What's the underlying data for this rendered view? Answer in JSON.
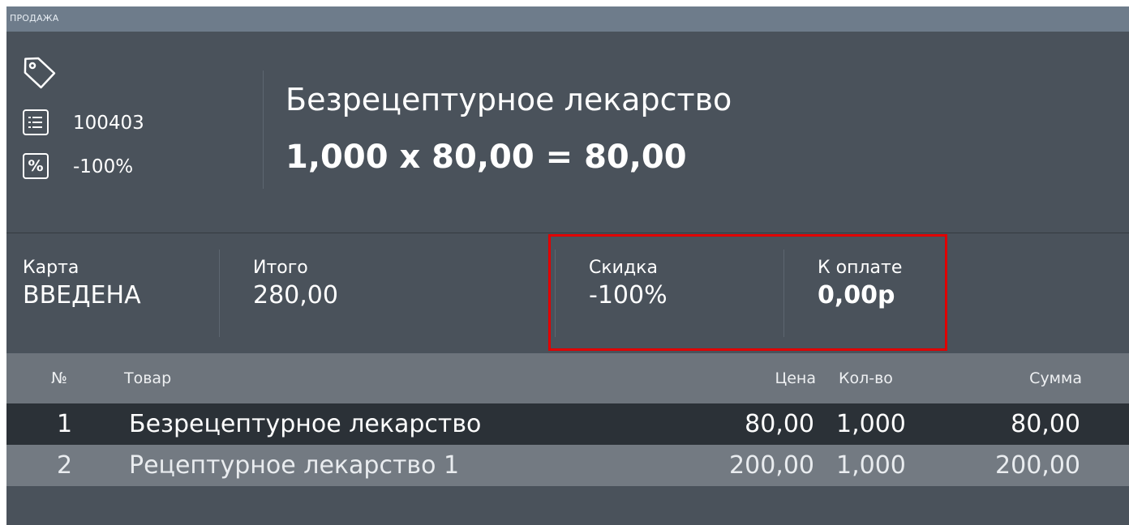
{
  "window": {
    "title": "ПРОДАЖА"
  },
  "product": {
    "code": "100403",
    "discount": "-100%",
    "name": "Безрецептурное лекарство",
    "calculation": "1,000 x 80,00 = 80,00"
  },
  "totals": {
    "card_label": "Карта",
    "card_value": "ВВЕДЕНА",
    "total_label": "Итого",
    "total_value": "280,00",
    "discount_label": "Скидка",
    "discount_value": "-100%",
    "pay_label": "К оплате",
    "pay_value": "0,00р"
  },
  "table": {
    "headers": {
      "num": "№",
      "item": "Товар",
      "price": "Цена",
      "qty": "Кол-во",
      "sum": "Сумма"
    },
    "rows": [
      {
        "num": "1",
        "item": "Безрецептурное лекарство",
        "price": "80,00",
        "qty": "1,000",
        "sum": "80,00"
      },
      {
        "num": "2",
        "item": "Рецептурное лекарство 1",
        "price": "200,00",
        "qty": "1,000",
        "sum": "200,00"
      }
    ]
  },
  "icons": [
    "tag-icon",
    "list-icon",
    "percent-icon"
  ],
  "colors": {
    "highlight": "#e00000",
    "panel": "#4a525b",
    "selected_row": "#2b3137"
  }
}
